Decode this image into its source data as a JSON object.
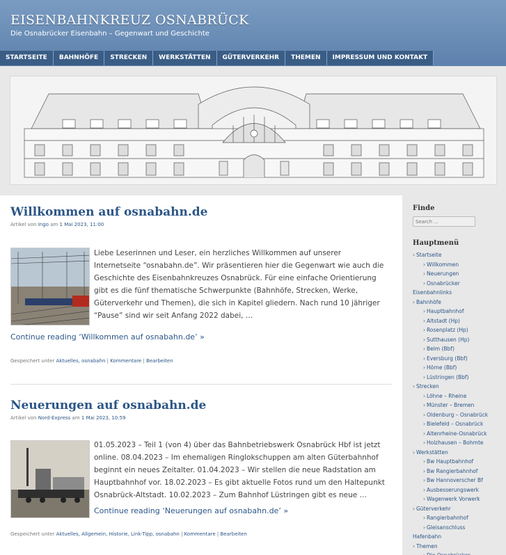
{
  "site": {
    "title": "EISENBAHNKREUZ OSNABRÜCK",
    "description": "Die Osnabrücker Eisenbahn – Gegenwart und Geschichte"
  },
  "nav": [
    "STARTSEITE",
    "BAHNHÖFE",
    "STRECKEN",
    "WERKSTÄTTEN",
    "GÜTERVERKEHR",
    "THEMEN",
    "IMPRESSUM UND KONTAKT"
  ],
  "posts": [
    {
      "title": "Willkommen auf osnabahn.de",
      "meta_prefix": "Artikel von",
      "author": "Ingo",
      "meta_mid": "am",
      "date": "1 Mai 2023, 11:00",
      "excerpt": "Liebe Leserinnen und Leser, ein herzliches Willkommen auf unserer Internetseite “osnabahn.de”. Wir präsentieren hier die Gegenwart wie auch die Geschichte des Eisenbahnkreuzes Osnabrück. Für eine einfache Orientierung gibt es die fünf thematische Schwerpunkte (Bahnhöfe, Strecken, Werke, Güterverkehr und Themen), die sich in Kapitel gliedern. Nach rund 10 jähriger “Pause” sind wir seit Anfang 2022 dabei, …",
      "read_more": "Continue reading ‘Willkommen auf osnabahn.de’ »",
      "footer_prefix": "Gespeichert unter",
      "categories": "Aktuelles, osnabahn",
      "comments": "Kommentare",
      "edit": "Bearbeiten"
    },
    {
      "title": "Neuerungen auf osnabahn.de",
      "meta_prefix": "Artikel von",
      "author": "Nord-Express",
      "meta_mid": "am",
      "date": "1 Mai 2023, 10:59",
      "excerpt": "01.05.2023 – Teil 1 (von 4) über das Bahnbetriebswerk Osnabrück Hbf ist jetzt online. 08.04.2023 – Im ehemaligen Ringlokschuppen am alten Güterbahnhof beginnt ein neues Zeitalter. 01.04.2023 – Wir stellen die neue Radstation am Hauptbahnhof vor. 18.02.2023 – Es gibt aktuelle Fotos rund um den Haltepunkt Osnabrück-Altstadt. 10.02.2023 – Zum Bahnhof Lüstringen gibt es neue …",
      "read_more": "Continue reading ‘Neuerungen auf osnabahn.de’ »",
      "footer_prefix": "Gespeichert unter",
      "categories": "Aktuelles, Allgemein, Historie, Link-Tipp, osnabahn",
      "comments": "Kommentare",
      "edit": "Bearbeiten"
    }
  ],
  "sidebar": {
    "find_title": "Finde",
    "search_placeholder": "Search ...",
    "menu_title": "Hauptmenü",
    "menu": [
      {
        "label": "Startseite",
        "level": 1
      },
      {
        "label": "Willkommen",
        "level": 2
      },
      {
        "label": "Neuerungen",
        "level": 2
      },
      {
        "label": "Osnabrücker",
        "level": 2
      },
      {
        "label": "Eisenbahnlinks",
        "level": 0
      },
      {
        "label": "Bahnhöfe",
        "level": 1
      },
      {
        "label": "Hauptbahnhof",
        "level": 2
      },
      {
        "label": "Altstadt (Hp)",
        "level": 2
      },
      {
        "label": "Rosenplatz (Hp)",
        "level": 2
      },
      {
        "label": "Sutthausen (Hp)",
        "level": 2
      },
      {
        "label": "Belm (Bbf)",
        "level": 2
      },
      {
        "label": "Eversburg (Bbf)",
        "level": 2
      },
      {
        "label": "Hörne (Bbf)",
        "level": 2
      },
      {
        "label": "Lüstringen (Bbf)",
        "level": 2
      },
      {
        "label": "Strecken",
        "level": 1
      },
      {
        "label": "Löhne – Rheine",
        "level": 2
      },
      {
        "label": "Münster – Bremen",
        "level": 2
      },
      {
        "label": "Oldenburg – Osnabrück",
        "level": 2
      },
      {
        "label": "Bielefeld – Osnabrück",
        "level": 2
      },
      {
        "label": "Altenrheine-Osnabrück",
        "level": 2
      },
      {
        "label": "Holzhausen – Bohmte",
        "level": 2
      },
      {
        "label": "Werkstätten",
        "level": 1
      },
      {
        "label": "Bw Hauptbahnhof",
        "level": 2
      },
      {
        "label": "Bw Rangierbahnhof",
        "level": 2
      },
      {
        "label": "Bw Hannoverscher Bf",
        "level": 2
      },
      {
        "label": "Ausbesserungswerk",
        "level": 2
      },
      {
        "label": "Wagenwerk Vorwerk",
        "level": 2
      },
      {
        "label": "Güterverkehr",
        "level": 1
      },
      {
        "label": "Rangierbahnhof",
        "level": 2
      },
      {
        "label": "Gleisanschluss",
        "level": 2
      },
      {
        "label": "Hafenbahn",
        "level": 0
      },
      {
        "label": "Themen",
        "level": 1
      },
      {
        "label": "Die Osnabrücker",
        "level": 2
      }
    ]
  }
}
